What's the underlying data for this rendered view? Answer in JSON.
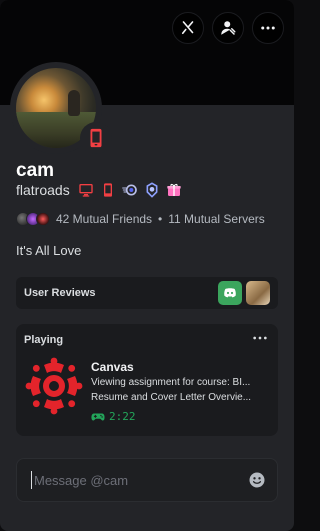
{
  "profile": {
    "display_name": "cam",
    "username": "flatroads",
    "bio": "It's All Love",
    "mutual_friends": "42 Mutual Friends",
    "separator": "•",
    "mutual_servers": "11 Mutual Servers"
  },
  "header_actions": [
    {
      "name": "no-voice-icon",
      "type": "icon"
    },
    {
      "name": "user-settings-icon",
      "type": "icon"
    },
    {
      "name": "more-options-icon",
      "type": "icon"
    }
  ],
  "badges": [
    "desktop-icon",
    "mobile-icon",
    "nitro-icon",
    "server-boost-icon",
    "gift-icon"
  ],
  "reviews": {
    "label": "User Reviews"
  },
  "activity": {
    "header": "Playing",
    "app_name": "Canvas",
    "details": "Viewing assignment for course: BI...",
    "state": "Resume and Cover Letter Overvie...",
    "elapsed": "2:22"
  },
  "message": {
    "placeholder": "Message @cam"
  },
  "colors": {
    "accent_red": "#f23f43",
    "online_green": "#23a55a",
    "canvas_red": "#e3242b",
    "card_bg": "#232428"
  }
}
